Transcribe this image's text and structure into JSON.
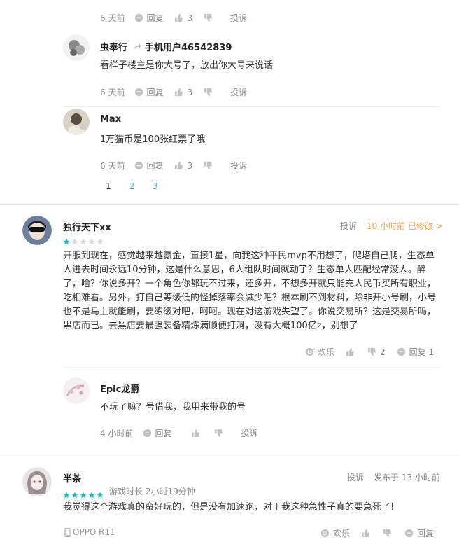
{
  "thread1": {
    "top_meta": {
      "time": "6 天前",
      "reply": "回复",
      "likes": "3",
      "report": "投诉"
    },
    "reply1": {
      "user": "虫奉行",
      "target": "手机用户46542839",
      "text": "看样子楼主是你大号了，放出你大号来说话",
      "meta": {
        "time": "6 天前",
        "reply": "回复",
        "likes": "3",
        "report": "投诉"
      }
    },
    "reply2": {
      "user": "Max",
      "text": "1万猫币是100张红票子哦",
      "meta": {
        "time": "6 天前",
        "reply": "回复",
        "likes": "3",
        "report": "投诉"
      }
    },
    "pages": [
      "1",
      "2",
      "3"
    ]
  },
  "review1": {
    "user": "独行天下xx",
    "rating": 1,
    "report": "投诉",
    "time": "10 小时前 已修改 >",
    "text": "开服到现在，感觉越来越氪金，直接1星，向我这种平民mvp不用想了，爬塔自己爬，生态单人进去时间永远10分钟，这是什么意思，6人组队时间就动了？生态单人匹配经常没人。醉了，啥？你说多开？一个角色你都玩不过来，还多开，不想多开就只能充人民币买所有职业，吃相难看。另外，打自己等级低的怪掉落率会减少吧？根本刷不到材料，除非开小号刷，小号也不是马上就能刷，要练级对吧，呵呵。现在对这游戏失望了。你说交易所？这是交易所吗，黑店而已。去黑店要最强装备精炼满顺便打洞，没有大概100亿z，别想了",
    "actions": {
      "funny": "欢乐",
      "likes": "2",
      "reply": "回复 1"
    },
    "reply": {
      "user": "Epic龙爵",
      "text": "不玩了嘛？号借我，我用来带我的号",
      "meta": {
        "time": "4 小时前",
        "reply": "回复",
        "report": "投诉"
      }
    }
  },
  "review2": {
    "user": "半茶",
    "rating": 5,
    "playtime": "游戏时长 2小时19分钟",
    "report": "投诉",
    "time": "发布于 13 小时前",
    "text": "我觉得这个游戏真的蛮好玩的，但是没有加速跑，对于我这种急性子真的要急死了!",
    "device": "OPPO R11",
    "actions": {
      "funny": "欢乐",
      "reply": "回复"
    }
  },
  "colors": {
    "accent": "#14b9c8",
    "orange": "#f39c3e",
    "star_empty": "#d8d8d8"
  },
  "icons": [
    "comment-icon",
    "thumbs-up-icon",
    "thumbs-down-icon",
    "smile-icon",
    "repost-arrow-icon",
    "phone-icon",
    "star-icon"
  ]
}
